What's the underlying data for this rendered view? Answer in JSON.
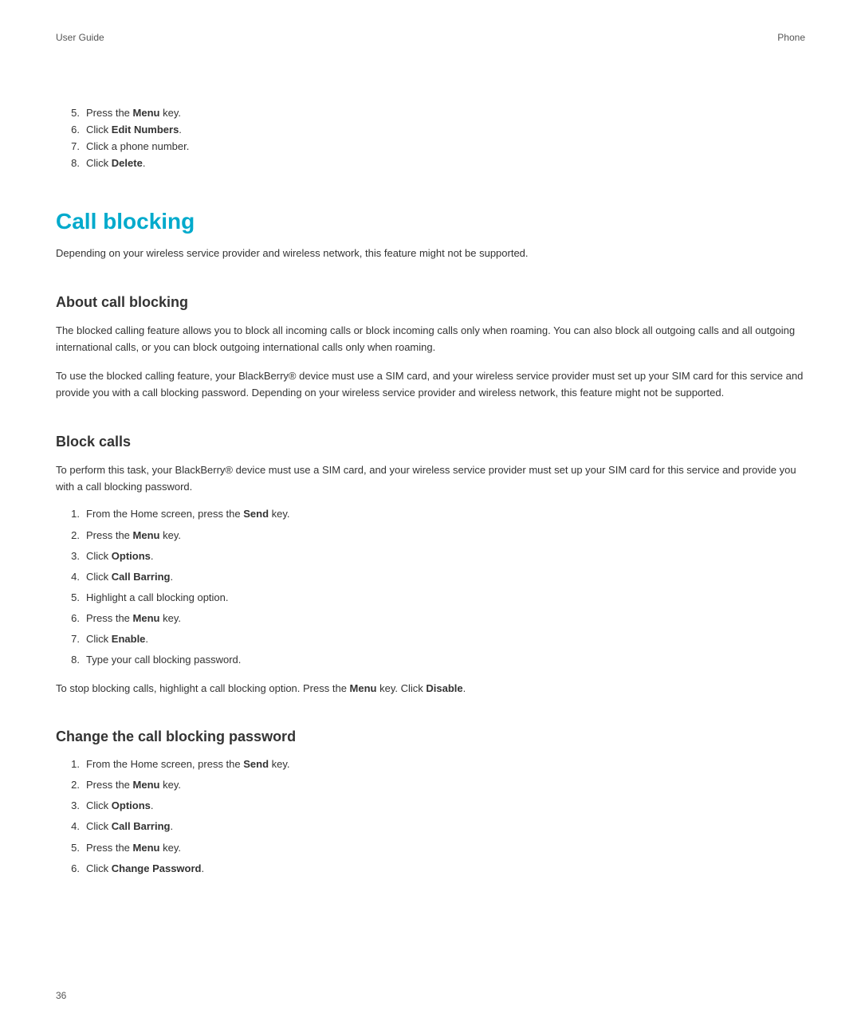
{
  "header": {
    "left": "User Guide",
    "right": "Phone"
  },
  "intro_steps": [
    {
      "num": "5.",
      "text": "Press the",
      "bold": "Menu",
      "after": " key."
    },
    {
      "num": "6.",
      "text": "Click",
      "bold": "Edit Numbers",
      "after": "."
    },
    {
      "num": "7.",
      "text": "Click a phone number.",
      "bold": null,
      "after": ""
    },
    {
      "num": "8.",
      "text": "Click",
      "bold": "Delete",
      "after": "."
    }
  ],
  "main_title": "Call blocking",
  "main_subtitle": "Depending on your wireless service provider and wireless network, this feature might not be supported.",
  "sections": [
    {
      "id": "about-call-blocking",
      "title": "About call blocking",
      "paragraphs": [
        "The blocked calling feature allows you to block all incoming calls or block incoming calls only when roaming. You can also block all outgoing calls and all outgoing international calls, or you can block outgoing international calls only when roaming.",
        "To use the blocked calling feature, your BlackBerry® device must use a SIM card, and your wireless service provider must set up your SIM card for this service and provide you with a call blocking password. Depending on your wireless service provider and wireless network, this feature might not be supported."
      ],
      "steps": []
    },
    {
      "id": "block-calls",
      "title": "Block calls",
      "paragraphs": [
        "To perform this task, your BlackBerry® device must use a SIM card, and your wireless service provider must set up your SIM card for this service and provide you with a call blocking password."
      ],
      "steps": [
        {
          "num": "1.",
          "text": "From the Home screen, press the",
          "bold": "Send",
          "after": " key."
        },
        {
          "num": "2.",
          "text": "Press the",
          "bold": "Menu",
          "after": " key."
        },
        {
          "num": "3.",
          "text": "Click",
          "bold": "Options",
          "after": "."
        },
        {
          "num": "4.",
          "text": "Click",
          "bold": "Call Barring",
          "after": "."
        },
        {
          "num": "5.",
          "text": "Highlight a call blocking option.",
          "bold": null,
          "after": ""
        },
        {
          "num": "6.",
          "text": "Press the",
          "bold": "Menu",
          "after": " key."
        },
        {
          "num": "7.",
          "text": "Click",
          "bold": "Enable",
          "after": "."
        },
        {
          "num": "8.",
          "text": "Type your call blocking password.",
          "bold": null,
          "after": ""
        }
      ],
      "note": "To stop blocking calls, highlight a call blocking option. Press the **Menu** key. Click **Disable**."
    },
    {
      "id": "change-password",
      "title": "Change the call blocking password",
      "paragraphs": [],
      "steps": [
        {
          "num": "1.",
          "text": "From the Home screen, press the",
          "bold": "Send",
          "after": " key."
        },
        {
          "num": "2.",
          "text": "Press the",
          "bold": "Menu",
          "after": " key."
        },
        {
          "num": "3.",
          "text": "Click",
          "bold": "Options",
          "after": "."
        },
        {
          "num": "4.",
          "text": "Click",
          "bold": "Call Barring",
          "after": "."
        },
        {
          "num": "5.",
          "text": "Press the",
          "bold": "Menu",
          "after": " key."
        },
        {
          "num": "6.",
          "text": "Click",
          "bold": "Change Password",
          "after": "."
        }
      ],
      "note": null
    }
  ],
  "footer": {
    "page_number": "36"
  }
}
